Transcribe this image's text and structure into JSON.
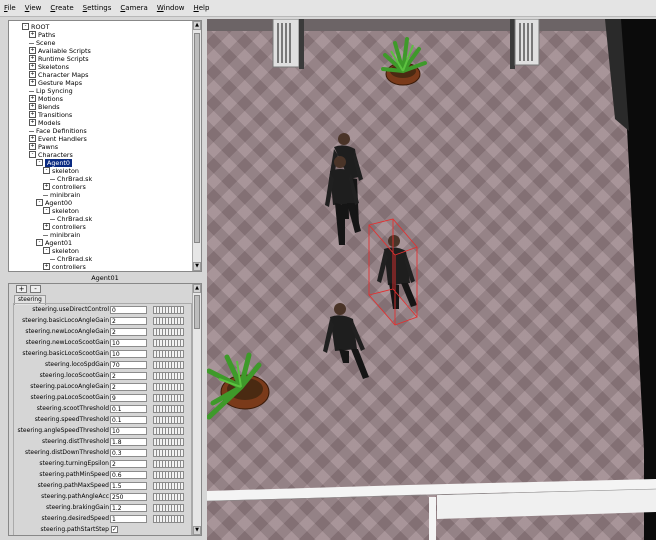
{
  "menu": [
    "File",
    "View",
    "Create",
    "Settings",
    "Camera",
    "Window",
    "Help"
  ],
  "tree": {
    "rows": [
      {
        "label": "ROOT",
        "level": 0,
        "toggle": "-"
      },
      {
        "label": "Paths",
        "level": 1,
        "toggle": "+"
      },
      {
        "label": "Scene",
        "level": 1,
        "toggle": ""
      },
      {
        "label": "Available Scripts",
        "level": 1,
        "toggle": "+"
      },
      {
        "label": "Runtime Scripts",
        "level": 1,
        "toggle": "+"
      },
      {
        "label": "Skeletons",
        "level": 1,
        "toggle": "+"
      },
      {
        "label": "Character Maps",
        "level": 1,
        "toggle": "+"
      },
      {
        "label": "Gesture Maps",
        "level": 1,
        "toggle": "+"
      },
      {
        "label": "Lip Syncing",
        "level": 1,
        "toggle": ""
      },
      {
        "label": "Motions",
        "level": 1,
        "toggle": "+"
      },
      {
        "label": "Blends",
        "level": 1,
        "toggle": "+"
      },
      {
        "label": "Transitions",
        "level": 1,
        "toggle": "+"
      },
      {
        "label": "Models",
        "level": 1,
        "toggle": "+"
      },
      {
        "label": "Face Definitions",
        "level": 1,
        "toggle": ""
      },
      {
        "label": "Event Handlers",
        "level": 1,
        "toggle": "+"
      },
      {
        "label": "Pawns",
        "level": 1,
        "toggle": "+"
      },
      {
        "label": "Characters",
        "level": 1,
        "toggle": "-"
      },
      {
        "label": "Agent0",
        "level": 2,
        "toggle": "-",
        "selected": true
      },
      {
        "label": "skeleton",
        "level": 3,
        "toggle": "-"
      },
      {
        "label": "ChrBrad.sk",
        "level": 4,
        "toggle": ""
      },
      {
        "label": "controllers",
        "level": 3,
        "toggle": "+"
      },
      {
        "label": "minibrain",
        "level": 3,
        "toggle": ""
      },
      {
        "label": "Agent00",
        "level": 2,
        "toggle": "-"
      },
      {
        "label": "skeleton",
        "level": 3,
        "toggle": "-"
      },
      {
        "label": "ChrBrad.sk",
        "level": 4,
        "toggle": ""
      },
      {
        "label": "controllers",
        "level": 3,
        "toggle": "+"
      },
      {
        "label": "minibrain",
        "level": 3,
        "toggle": ""
      },
      {
        "label": "Agent01",
        "level": 2,
        "toggle": "-"
      },
      {
        "label": "skeleton",
        "level": 3,
        "toggle": "-"
      },
      {
        "label": "ChrBrad.sk",
        "level": 4,
        "toggle": ""
      },
      {
        "label": "controllers",
        "level": 3,
        "toggle": "+"
      }
    ]
  },
  "properties_panel": {
    "title": "Agent01",
    "add_label": "+",
    "remove_label": "-",
    "group_label": "steering",
    "rows": [
      {
        "label": "steering.useDirectControl",
        "value": "0"
      },
      {
        "label": "steering.basicLocoAngleGain",
        "value": "2"
      },
      {
        "label": "steering.newLocoAngleGain",
        "value": "2"
      },
      {
        "label": "steering.newLocoScootGain",
        "value": "10"
      },
      {
        "label": "steering.basicLocoScootGain",
        "value": "10"
      },
      {
        "label": "steering.locoSpdGain",
        "value": "70"
      },
      {
        "label": "steering.locoScootGain",
        "value": "2"
      },
      {
        "label": "steering.paLocoAngleGain",
        "value": "2"
      },
      {
        "label": "steering.paLocoScootGain",
        "value": "9"
      },
      {
        "label": "steering.scootThreshold",
        "value": "0.1"
      },
      {
        "label": "steering.speedThreshold",
        "value": "0.1"
      },
      {
        "label": "steering.angleSpeedThreshold",
        "value": "10"
      },
      {
        "label": "steering.distThreshold",
        "value": "1.8"
      },
      {
        "label": "steering.distDownThreshold",
        "value": "0.3"
      },
      {
        "label": "steering.turningEpsilon",
        "value": "2"
      },
      {
        "label": "steering.pathMinSpeed",
        "value": "0.6"
      },
      {
        "label": "steering.pathMaxSpeed",
        "value": "1.5"
      },
      {
        "label": "steering.pathAngleAcc",
        "value": "250"
      },
      {
        "label": "steering.brakingGain",
        "value": "1.2"
      },
      {
        "label": "steering.desiredSpeed",
        "value": "1"
      },
      {
        "label": "steering.pathStartStep",
        "value": "",
        "checkbox": true,
        "check_mark": "✓"
      }
    ]
  },
  "viewport": {
    "colors": {
      "floor": "#9a8489",
      "wall": "#0b0b0b",
      "rail": "#f4f4f4",
      "selection": "#e23030"
    }
  }
}
